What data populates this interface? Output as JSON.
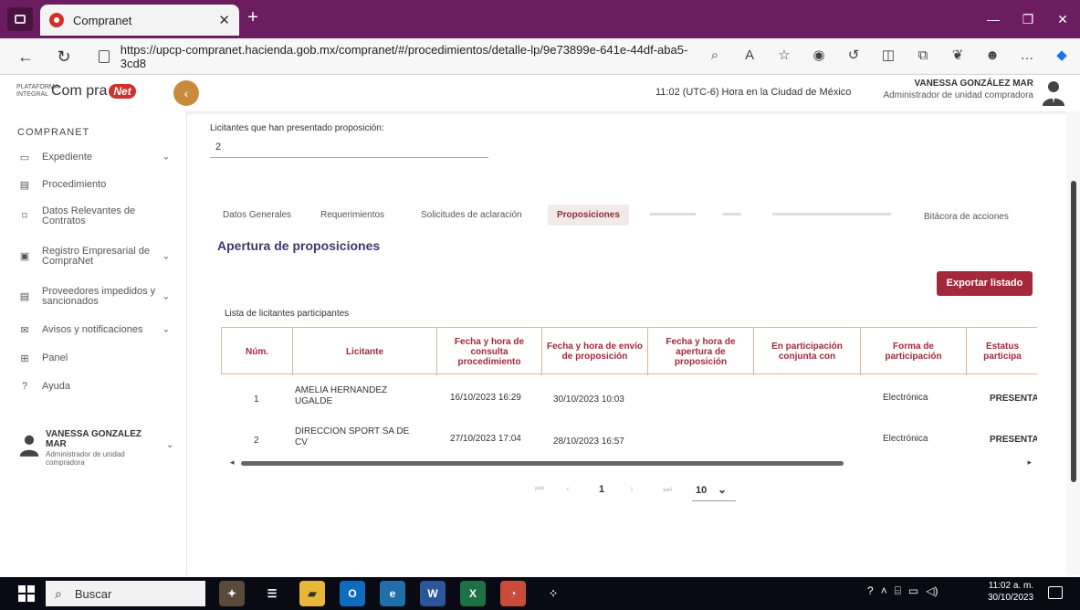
{
  "browser": {
    "tab_title": "Compranet",
    "url": "https://upcp-compranet.hacienda.gob.mx/compranet/#/procedimientos/detalle-lp/9e73899e-641e-44df-aba5-3cd8"
  },
  "header": {
    "logo_small": "PLATAFORMA INTEGRAL",
    "logo_main": "Com pra",
    "logo_badge": "Net",
    "clock": "11:02 (UTC-6) Hora en la Ciudad de México",
    "user_name": "VANESSA GONZÁLEZ MAR",
    "user_role": "Administrador de unidad compradora"
  },
  "sidebar": {
    "heading": "COMPRANET",
    "items": [
      {
        "label": "Expediente",
        "icon": "folder-icon",
        "chevron": true
      },
      {
        "label": "Procedimiento",
        "icon": "document-icon",
        "chevron": false
      },
      {
        "label": "Datos Relevantes de Contratos",
        "icon": "bookmark-icon",
        "chevron": false
      },
      {
        "label": "Registro Empresarial de CompraNet",
        "icon": "id-card-icon",
        "chevron": true
      },
      {
        "label": "Proveedores impedidos y sancionados",
        "icon": "briefcase-icon",
        "chevron": true
      },
      {
        "label": "Avisos y notificaciones",
        "icon": "mail-icon",
        "chevron": true
      },
      {
        "label": "Panel",
        "icon": "grid-icon",
        "chevron": false
      },
      {
        "label": "Ayuda",
        "icon": "help-icon",
        "chevron": false
      }
    ],
    "user_name": "VANESSA GONZALEZ MAR",
    "user_role": "Administrador de unidad compradora"
  },
  "main": {
    "licitantes_label": "Licitantes que han presentado proposición:",
    "licitantes_value": "2",
    "tabs": [
      {
        "label": "Datos Generales",
        "state": "normal"
      },
      {
        "label": "Requerimientos",
        "state": "normal"
      },
      {
        "label": "Solicitudes de aclaración",
        "state": "normal"
      },
      {
        "label": "Proposiciones",
        "state": "active"
      },
      {
        "label": "Bitácora de acciones",
        "state": "normal"
      }
    ],
    "section_title": "Apertura de proposiciones",
    "export_label": "Exportar listado",
    "list_label": "Lista de licitantes participantes",
    "columns": [
      "Núm.",
      "Licitante",
      "Fecha y hora de consulta procedimiento",
      "Fecha y hora de envío de proposición",
      "Fecha y hora de apertura de proposición",
      "En participación conjunta con",
      "Forma de participación",
      "Estatus participa"
    ],
    "rows": [
      {
        "num": "1",
        "licitante": "AMELIA HERNANDEZ UGALDE",
        "consulta": "16/10/2023 16:29",
        "envio": "30/10/2023 10:03",
        "apertura": "",
        "conjunta": "",
        "forma": "Electrónica",
        "estatus": "PRESENTA"
      },
      {
        "num": "2",
        "licitante": "DIRECCION SPORT SA DE CV",
        "consulta": "27/10/2023 17:04",
        "envio": "28/10/2023 16:57",
        "apertura": "",
        "conjunta": "",
        "forma": "Electrónica",
        "estatus": "PRESENTA"
      }
    ],
    "pager": {
      "current": "1",
      "page_size": "10"
    }
  },
  "taskbar": {
    "search_placeholder": "Buscar",
    "time": "11:02 a. m.",
    "date": "30/10/2023"
  },
  "colors": {
    "browser_frame": "#6b1d5f",
    "accent": "#a3283a",
    "title": "#3b3b6b"
  }
}
